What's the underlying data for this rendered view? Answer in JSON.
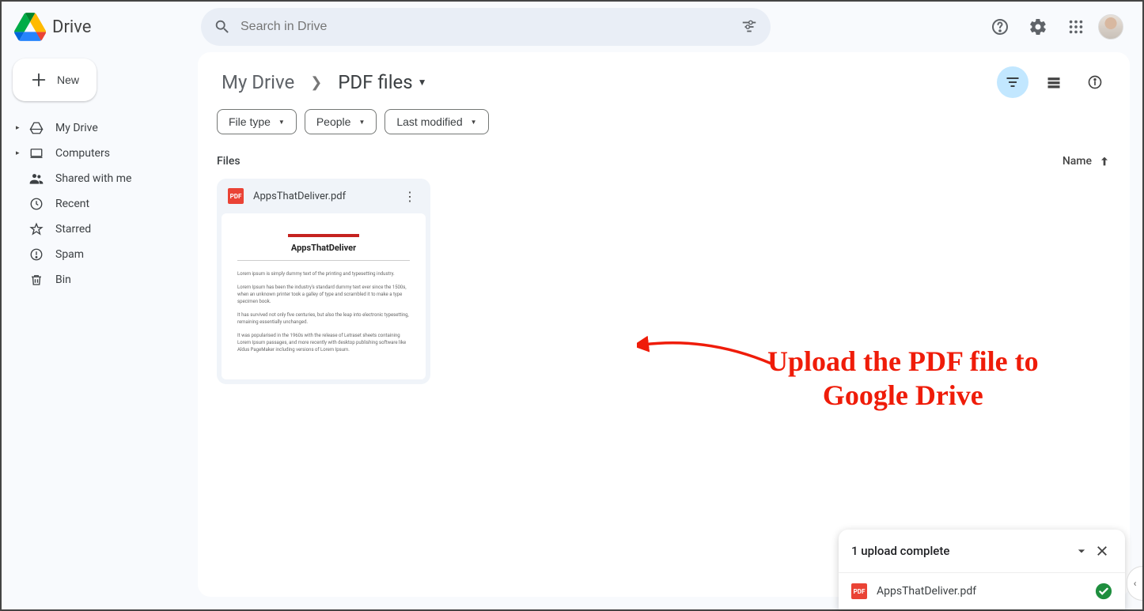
{
  "header": {
    "app_name": "Drive",
    "search_placeholder": "Search in Drive"
  },
  "sidebar": {
    "new_label": "New",
    "items": [
      {
        "label": "My Drive",
        "icon": "my-drive",
        "expandable": true
      },
      {
        "label": "Computers",
        "icon": "computers",
        "expandable": true
      },
      {
        "label": "Shared with me",
        "icon": "shared",
        "expandable": false
      },
      {
        "label": "Recent",
        "icon": "recent",
        "expandable": false
      },
      {
        "label": "Starred",
        "icon": "starred",
        "expandable": false
      },
      {
        "label": "Spam",
        "icon": "spam",
        "expandable": false
      },
      {
        "label": "Bin",
        "icon": "bin",
        "expandable": false
      }
    ]
  },
  "breadcrumb": {
    "root": "My Drive",
    "current": "PDF files"
  },
  "filters": [
    {
      "label": "File type"
    },
    {
      "label": "People"
    },
    {
      "label": "Last modified"
    }
  ],
  "section_label": "Files",
  "sort_label": "Name",
  "files": [
    {
      "name": "AppsThatDeliver.pdf",
      "type": "pdf",
      "thumb_title": "AppsThatDeliver"
    }
  ],
  "annotation": {
    "text_line1": "Upload the PDF file to",
    "text_line2": "Google Drive"
  },
  "upload_toast": {
    "title": "1 upload complete",
    "item_name": "AppsThatDeliver.pdf"
  }
}
